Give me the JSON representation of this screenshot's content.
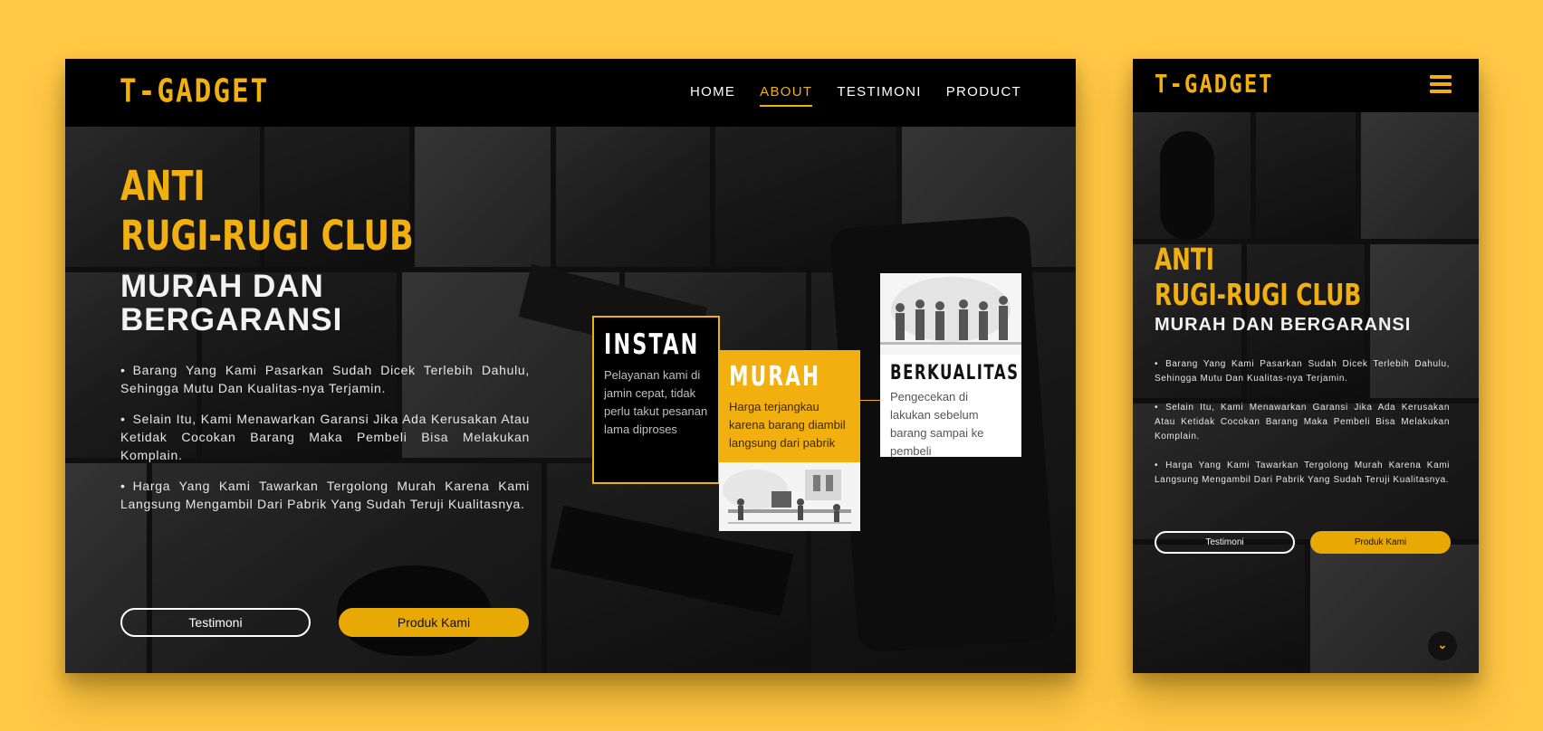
{
  "brand": {
    "logo": "T-GADGET"
  },
  "nav": {
    "items": [
      {
        "label": "HOME",
        "active": false
      },
      {
        "label": "ABOUT",
        "active": true
      },
      {
        "label": "TESTIMONI",
        "active": false
      },
      {
        "label": "PRODUCT",
        "active": false
      }
    ]
  },
  "hero": {
    "title_line1": "ANTI",
    "title_line2": "RUGI-RUGI CLUB",
    "subtitle": "MURAH DAN BERGARANSI",
    "points": [
      "Barang Yang Kami Pasarkan Sudah Dicek Terlebih Dahulu, Sehingga Mutu Dan Kualitas-nya Terjamin.",
      "Selain Itu, Kami Menawarkan Garansi Jika Ada Kerusakan Atau Ketidak Cocokan Barang Maka Pembeli Bisa Melakukan Komplain.",
      "Harga Yang Kami Tawarkan Tergolong Murah Karena Kami Langsung Mengambil Dari Pabrik Yang Sudah Teruji Kualitasnya."
    ],
    "buttons": {
      "testimoni": "Testimoni",
      "produk": "Produk Kami"
    }
  },
  "features": {
    "instan": {
      "title": "INSTAN",
      "desc": "Pelayanan kami di jamin cepat, tidak perlu takut pesanan lama diproses"
    },
    "murah": {
      "title": "MURAH",
      "desc": "Harga terjangkau karena barang diambil langsung dari pabrik"
    },
    "kualitas": {
      "title": "BERKUALITAS",
      "desc": "Pengecekan di lakukan sebelum barang sampai ke pembeli"
    }
  },
  "icons": {
    "menu": "hamburger-icon",
    "scroll": "chevron-down-icon"
  },
  "colors": {
    "accent": "#F2B010",
    "background": "#FFC845",
    "nav": "#000000"
  }
}
